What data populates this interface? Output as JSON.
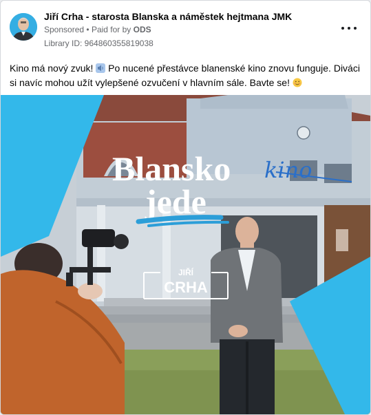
{
  "ad": {
    "advertiser_name": "Jiří Crha - starosta Blanska a náměstek hejtmana JMK",
    "sponsored_label": "Sponsored",
    "separator": "•",
    "paid_by_prefix": "Paid for by",
    "paid_by_name": "ODS",
    "library_id": "Library ID: 964860355819038",
    "more_icon": "more-options-icon"
  },
  "post": {
    "text_part1": "Kino má nový zvuk! ",
    "text_part2": "Po nucené přestávce blanenské kino znovu funguje. Diváci si navíc mohou užít vylepšené ozvučení v hlavním sále. Bavte se! ",
    "emoji_1": "speaker-icon",
    "emoji_2": "smiling-face-icon"
  },
  "image": {
    "title_line1": "Blansko",
    "title_line2": "jede",
    "cinema_sign": "kino",
    "candidate_first_name": "JIŘÍ",
    "candidate_last_name": "CRHA",
    "accent_color": "#33b8ea",
    "underline_color": "#2c9ed8"
  }
}
